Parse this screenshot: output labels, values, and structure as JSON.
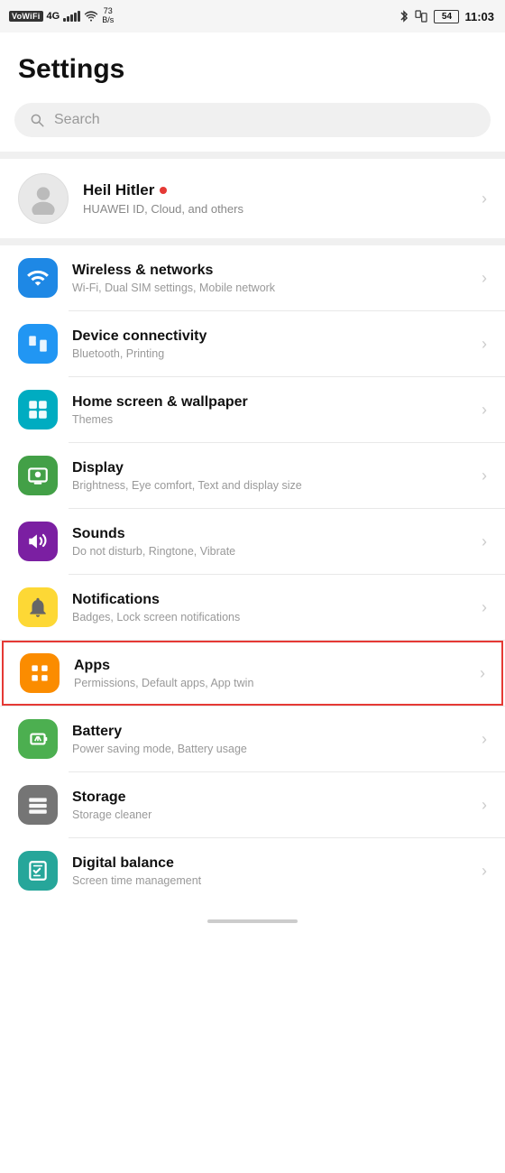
{
  "statusBar": {
    "wifiLabel": "VoWiFi",
    "signal4g": "4G",
    "signalBars": [
      3,
      5,
      7,
      9,
      11
    ],
    "wifiSignal": "WiFi",
    "speed": "73\nB/s",
    "bluetooth": "⁸",
    "battery": "54",
    "time": "11:03"
  },
  "header": {
    "title": "Settings"
  },
  "search": {
    "placeholder": "Search"
  },
  "profile": {
    "name": "Heil Hitler",
    "nameDot": "●",
    "subtitle": "HUAWEI ID, Cloud, and others"
  },
  "settingsItems": [
    {
      "id": "wireless",
      "title": "Wireless & networks",
      "subtitle": "Wi-Fi, Dual SIM settings, Mobile network",
      "iconColor": "icon-blue",
      "iconType": "wifi"
    },
    {
      "id": "device",
      "title": "Device connectivity",
      "subtitle": "Bluetooth, Printing",
      "iconColor": "icon-blue2",
      "iconType": "device"
    },
    {
      "id": "homescreen",
      "title": "Home screen & wallpaper",
      "subtitle": "Themes",
      "iconColor": "icon-teal",
      "iconType": "homescreen"
    },
    {
      "id": "display",
      "title": "Display",
      "subtitle": "Brightness, Eye comfort, Text and display size",
      "iconColor": "icon-green",
      "iconType": "display"
    },
    {
      "id": "sounds",
      "title": "Sounds",
      "subtitle": "Do not disturb, Ringtone, Vibrate",
      "iconColor": "icon-purple",
      "iconType": "sounds"
    },
    {
      "id": "notifications",
      "title": "Notifications",
      "subtitle": "Badges, Lock screen notifications",
      "iconColor": "icon-yellow",
      "iconType": "notifications"
    },
    {
      "id": "apps",
      "title": "Apps",
      "subtitle": "Permissions, Default apps, App twin",
      "iconColor": "icon-orange",
      "iconType": "apps",
      "highlighted": true
    },
    {
      "id": "battery",
      "title": "Battery",
      "subtitle": "Power saving mode, Battery usage",
      "iconColor": "icon-green2",
      "iconType": "battery"
    },
    {
      "id": "storage",
      "title": "Storage",
      "subtitle": "Storage cleaner",
      "iconColor": "icon-gray",
      "iconType": "storage"
    },
    {
      "id": "digitalbalance",
      "title": "Digital balance",
      "subtitle": "Screen time management",
      "iconColor": "icon-teal2",
      "iconType": "digitalbalance"
    }
  ]
}
